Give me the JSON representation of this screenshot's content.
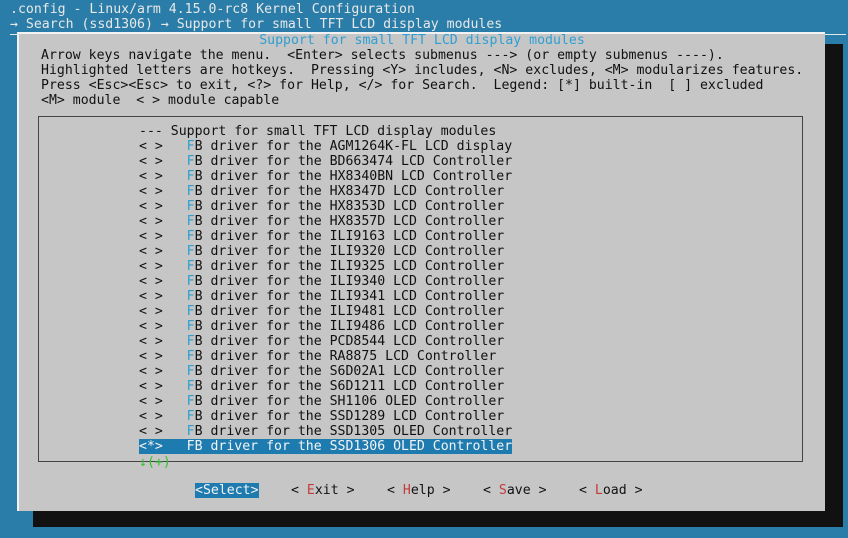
{
  "terminal": {
    "title": ".config - Linux/arm 4.15.0-rc8 Kernel Configuration",
    "breadcrumb": "→ Search (ssd1306) → Support for small TFT LCD display modules"
  },
  "dialog": {
    "title": "Support for small TFT LCD display modules",
    "help_lines": [
      "Arrow keys navigate the menu.  <Enter> selects submenus ---> (or empty submenus ----).",
      "Highlighted letters are hotkeys.  Pressing <Y> includes, <N> excludes, <M> modularizes features.",
      "Press <Esc><Esc> to exit, <?> for Help, </> for Search.  Legend: [*] built-in  [ ] excluded",
      "<M> module  < > module capable"
    ]
  },
  "menu": {
    "header": "--- Support for small TFT LCD display modules",
    "items": [
      {
        "state": "< >",
        "hotkey": "F",
        "rest": "B driver for the AGM1264K-FL LCD display"
      },
      {
        "state": "< >",
        "hotkey": "F",
        "rest": "B driver for the BD663474 LCD Controller"
      },
      {
        "state": "< >",
        "hotkey": "F",
        "rest": "B driver for the HX8340BN LCD Controller"
      },
      {
        "state": "< >",
        "hotkey": "F",
        "rest": "B driver for the HX8347D LCD Controller"
      },
      {
        "state": "< >",
        "hotkey": "F",
        "rest": "B driver for the HX8353D LCD Controller"
      },
      {
        "state": "< >",
        "hotkey": "F",
        "rest": "B driver for the HX8357D LCD Controller"
      },
      {
        "state": "< >",
        "hotkey": "F",
        "rest": "B driver for the ILI9163 LCD Controller"
      },
      {
        "state": "< >",
        "hotkey": "F",
        "rest": "B driver for the ILI9320 LCD Controller"
      },
      {
        "state": "< >",
        "hotkey": "F",
        "rest": "B driver for the ILI9325 LCD Controller"
      },
      {
        "state": "< >",
        "hotkey": "F",
        "rest": "B driver for the ILI9340 LCD Controller"
      },
      {
        "state": "< >",
        "hotkey": "F",
        "rest": "B driver for the ILI9341 LCD Controller"
      },
      {
        "state": "< >",
        "hotkey": "F",
        "rest": "B driver for the ILI9481 LCD Controller"
      },
      {
        "state": "< >",
        "hotkey": "F",
        "rest": "B driver for the ILI9486 LCD Controller"
      },
      {
        "state": "< >",
        "hotkey": "F",
        "rest": "B driver for the PCD8544 LCD Controller"
      },
      {
        "state": "< >",
        "hotkey": "F",
        "rest": "B driver for the RA8875 LCD Controller"
      },
      {
        "state": "< >",
        "hotkey": "F",
        "rest": "B driver for the S6D02A1 LCD Controller"
      },
      {
        "state": "< >",
        "hotkey": "F",
        "rest": "B driver for the S6D1211 LCD Controller"
      },
      {
        "state": "< >",
        "hotkey": "F",
        "rest": "B driver for the SH1106 OLED Controller"
      },
      {
        "state": "< >",
        "hotkey": "F",
        "rest": "B driver for the SSD1289 LCD Controller"
      },
      {
        "state": "< >",
        "hotkey": "F",
        "rest": "B driver for the SSD1305 OLED Controller"
      },
      {
        "state": "<*>",
        "hotkey": "F",
        "rest": "B driver for the SSD1306 OLED Controller",
        "selected": true
      }
    ],
    "more_indicator": "↓(+)"
  },
  "buttons": {
    "select": "<Select>",
    "exit": {
      "pre": "< ",
      "hotkey": "E",
      "post": "xit >"
    },
    "help": {
      "pre": "< ",
      "hotkey": "H",
      "post": "elp >"
    },
    "save": {
      "pre": "< ",
      "hotkey": "S",
      "post": "ave >"
    },
    "load": {
      "pre": "< ",
      "hotkey": "L",
      "post": "oad >"
    }
  },
  "colors": {
    "terminal_bg": "#2a7da8",
    "dialog_bg": "#c6c6c6",
    "selection_bg": "#1e7bb0",
    "hotkey": "#2e9fd2",
    "button_hotkey": "#c33c3c",
    "indicator": "#2ec42e"
  }
}
